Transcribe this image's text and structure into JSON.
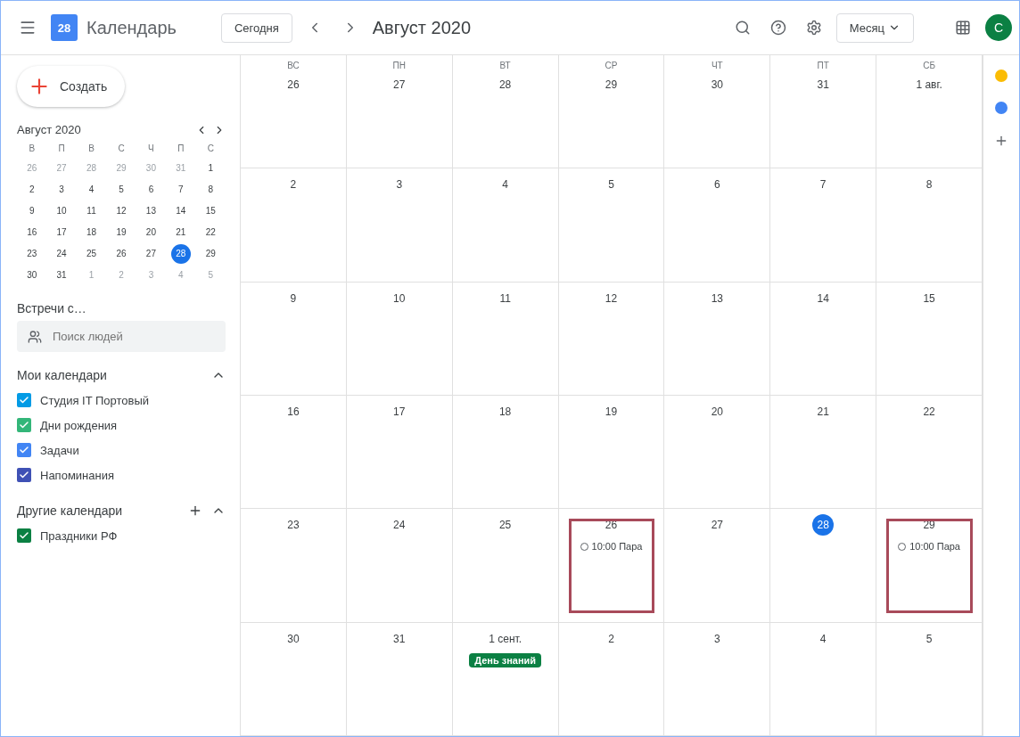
{
  "header": {
    "app_name": "Календарь",
    "logo_text": "28",
    "today_button": "Сегодня",
    "title": "Август 2020",
    "view_selector": "Месяц",
    "avatar": "С"
  },
  "create_button": "Создать",
  "mini_calendar": {
    "title": "Август 2020",
    "weekdays": [
      "В",
      "П",
      "В",
      "С",
      "Ч",
      "П",
      "С"
    ],
    "weeks": [
      [
        {
          "day": "26",
          "outside": true,
          "selected": false
        },
        {
          "day": "27",
          "outside": true,
          "selected": false
        },
        {
          "day": "28",
          "outside": true,
          "selected": false
        },
        {
          "day": "29",
          "outside": true,
          "selected": false
        },
        {
          "day": "30",
          "outside": true,
          "selected": false
        },
        {
          "day": "31",
          "outside": true,
          "selected": false
        },
        {
          "day": "1",
          "outside": false,
          "selected": false
        }
      ],
      [
        {
          "day": "2",
          "outside": false,
          "selected": false
        },
        {
          "day": "3",
          "outside": false,
          "selected": false
        },
        {
          "day": "4",
          "outside": false,
          "selected": false
        },
        {
          "day": "5",
          "outside": false,
          "selected": false
        },
        {
          "day": "6",
          "outside": false,
          "selected": false
        },
        {
          "day": "7",
          "outside": false,
          "selected": false
        },
        {
          "day": "8",
          "outside": false,
          "selected": false
        }
      ],
      [
        {
          "day": "9",
          "outside": false,
          "selected": false
        },
        {
          "day": "10",
          "outside": false,
          "selected": false
        },
        {
          "day": "11",
          "outside": false,
          "selected": false
        },
        {
          "day": "12",
          "outside": false,
          "selected": false
        },
        {
          "day": "13",
          "outside": false,
          "selected": false
        },
        {
          "day": "14",
          "outside": false,
          "selected": false
        },
        {
          "day": "15",
          "outside": false,
          "selected": false
        }
      ],
      [
        {
          "day": "16",
          "outside": false,
          "selected": false
        },
        {
          "day": "17",
          "outside": false,
          "selected": false
        },
        {
          "day": "18",
          "outside": false,
          "selected": false
        },
        {
          "day": "19",
          "outside": false,
          "selected": false
        },
        {
          "day": "20",
          "outside": false,
          "selected": false
        },
        {
          "day": "21",
          "outside": false,
          "selected": false
        },
        {
          "day": "22",
          "outside": false,
          "selected": false
        }
      ],
      [
        {
          "day": "23",
          "outside": false,
          "selected": false
        },
        {
          "day": "24",
          "outside": false,
          "selected": false
        },
        {
          "day": "25",
          "outside": false,
          "selected": false
        },
        {
          "day": "26",
          "outside": false,
          "selected": false
        },
        {
          "day": "27",
          "outside": false,
          "selected": false
        },
        {
          "day": "28",
          "outside": false,
          "selected": true
        },
        {
          "day": "29",
          "outside": false,
          "selected": false
        }
      ],
      [
        {
          "day": "30",
          "outside": false,
          "selected": false
        },
        {
          "day": "31",
          "outside": false,
          "selected": false
        },
        {
          "day": "1",
          "outside": true,
          "selected": false
        },
        {
          "day": "2",
          "outside": true,
          "selected": false
        },
        {
          "day": "3",
          "outside": true,
          "selected": false
        },
        {
          "day": "4",
          "outside": true,
          "selected": false
        },
        {
          "day": "5",
          "outside": true,
          "selected": false
        }
      ]
    ]
  },
  "meet_title": "Встречи с…",
  "people_search": {
    "placeholder": "Поиск людей"
  },
  "my_calendars": {
    "title": "Мои календари",
    "items": [
      {
        "label": "Студия IT Портовый",
        "color": "#039be5",
        "checked": true
      },
      {
        "label": "Дни рождения",
        "color": "#33b679",
        "checked": true
      },
      {
        "label": "Задачи",
        "color": "#4285f4",
        "checked": true
      },
      {
        "label": "Напоминания",
        "color": "#3f51b5",
        "checked": true
      }
    ]
  },
  "other_calendars": {
    "title": "Другие календари",
    "items": [
      {
        "label": "Праздники РФ",
        "color": "#0b8043",
        "checked": true
      }
    ]
  },
  "month": {
    "weekdays": [
      "ВС",
      "ПН",
      "ВТ",
      "СР",
      "ЧТ",
      "ПТ",
      "СБ"
    ],
    "weeks": [
      [
        {
          "day": "26"
        },
        {
          "day": "27"
        },
        {
          "day": "28"
        },
        {
          "day": "29"
        },
        {
          "day": "30"
        },
        {
          "day": "31"
        },
        {
          "day": "1 авг."
        }
      ],
      [
        {
          "day": "2"
        },
        {
          "day": "3"
        },
        {
          "day": "4"
        },
        {
          "day": "5"
        },
        {
          "day": "6"
        },
        {
          "day": "7"
        },
        {
          "day": "8"
        }
      ],
      [
        {
          "day": "9"
        },
        {
          "day": "10"
        },
        {
          "day": "11"
        },
        {
          "day": "12"
        },
        {
          "day": "13"
        },
        {
          "day": "14"
        },
        {
          "day": "15"
        }
      ],
      [
        {
          "day": "16"
        },
        {
          "day": "17"
        },
        {
          "day": "18"
        },
        {
          "day": "19"
        },
        {
          "day": "20"
        },
        {
          "day": "21"
        },
        {
          "day": "22"
        }
      ],
      [
        {
          "day": "23"
        },
        {
          "day": "24"
        },
        {
          "day": "25"
        },
        {
          "day": "26",
          "outlined": true,
          "events": [
            {
              "text": "10:00 Пара",
              "kind": "timed"
            }
          ]
        },
        {
          "day": "27"
        },
        {
          "day": "28",
          "today": true
        },
        {
          "day": "29",
          "outlined": true,
          "events": [
            {
              "text": "10:00 Пара",
              "kind": "timed"
            }
          ]
        }
      ],
      [
        {
          "day": "30"
        },
        {
          "day": "31"
        },
        {
          "day": "1 сент.",
          "events": [
            {
              "text": "День знаний",
              "kind": "allday"
            }
          ]
        },
        {
          "day": "2"
        },
        {
          "day": "3"
        },
        {
          "day": "4"
        },
        {
          "day": "5"
        }
      ]
    ]
  }
}
